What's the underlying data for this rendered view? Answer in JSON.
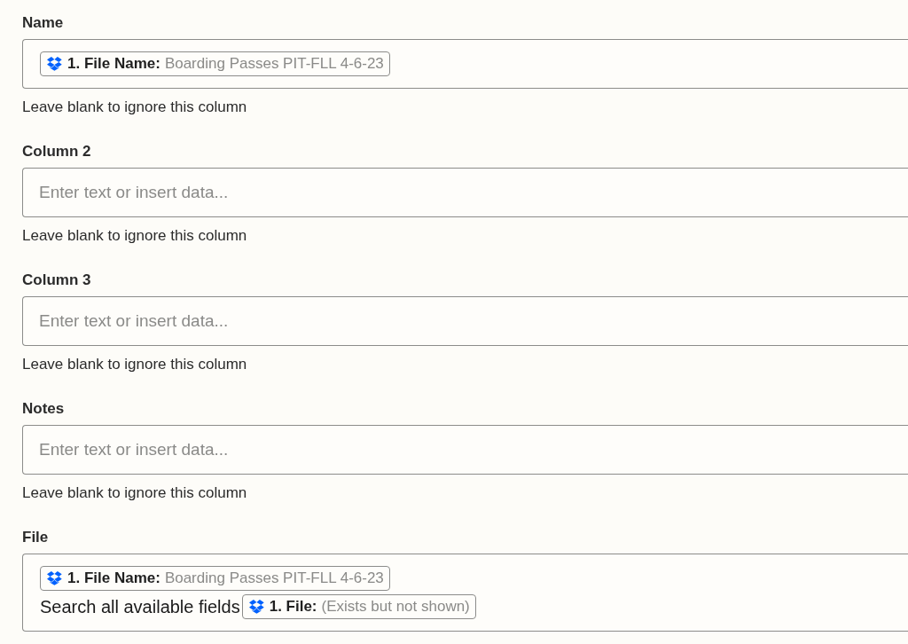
{
  "fields": [
    {
      "label": "Name",
      "lines": [
        [
          {
            "kind": "token",
            "key": "1. File Name:",
            "value": "Boarding Passes PIT-FLL 4-6-23"
          }
        ]
      ],
      "hint": "Leave blank to ignore this column"
    },
    {
      "label": "Column 2",
      "placeholder": "Enter text or insert data...",
      "hint": "Leave blank to ignore this column"
    },
    {
      "label": "Column 3",
      "placeholder": "Enter text or insert data...",
      "hint": "Leave blank to ignore this column"
    },
    {
      "label": "Notes",
      "placeholder": "Enter text or insert data...",
      "hint": "Leave blank to ignore this column"
    },
    {
      "label": "File",
      "lines": [
        [
          {
            "kind": "token",
            "key": "1. File Name:",
            "value": "Boarding Passes PIT-FLL 4-6-23"
          }
        ],
        [
          {
            "kind": "text",
            "text": "Search all available fields"
          },
          {
            "kind": "token",
            "key": "1. File:",
            "value": "(Exists but not shown)"
          }
        ]
      ]
    }
  ]
}
